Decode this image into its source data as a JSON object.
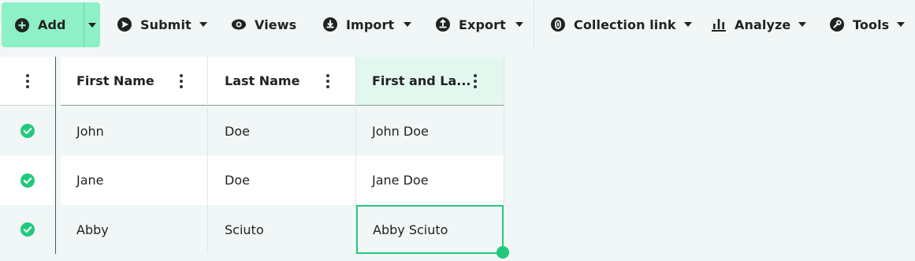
{
  "toolbar": {
    "add_label": "Add",
    "submit_label": "Submit",
    "views_label": "Views",
    "import_label": "Import",
    "export_label": "Export",
    "collection_link_label": "Collection link",
    "analyze_label": "Analyze",
    "tools_label": "Tools"
  },
  "table": {
    "columns": [
      "First Name",
      "Last Name",
      "First and La..."
    ],
    "rows": [
      {
        "status": "complete",
        "cells": [
          "John",
          "Doe",
          "John Doe"
        ]
      },
      {
        "status": "complete",
        "cells": [
          "Jane",
          "Doe",
          "Jane Doe"
        ]
      },
      {
        "status": "complete",
        "cells": [
          "Abby",
          "Sciuto",
          "Abby Sciuto"
        ]
      }
    ]
  },
  "colors": {
    "accent": "#8ef0c6",
    "selection": "#22c97d",
    "check": "#22c97d",
    "selected_column_header": "#e2f8ef",
    "background": "#f1f7f6"
  }
}
